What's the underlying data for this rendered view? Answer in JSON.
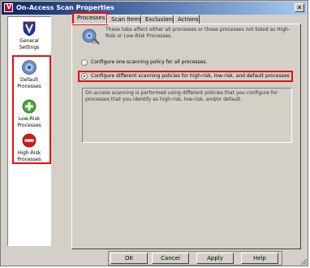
{
  "window": {
    "title": "On-Access Scan Properties",
    "close_label": "✕"
  },
  "sidebar": {
    "items": [
      {
        "id": "general",
        "label_line1": "General",
        "label_line2": "Settings",
        "icon": "shield-v-icon"
      },
      {
        "id": "default",
        "label_line1": "Default",
        "label_line2": "Processes",
        "icon": "gear-disc-icon"
      },
      {
        "id": "lowrisk",
        "label_line1": "Low-Risk",
        "label_line2": "Processes",
        "icon": "green-plus-icon"
      },
      {
        "id": "highrisk",
        "label_line1": "High-Risk",
        "label_line2": "Processes",
        "icon": "red-minus-icon"
      }
    ]
  },
  "tabs": [
    {
      "label": "Processes",
      "active": true
    },
    {
      "label": "Scan Items",
      "active": false
    },
    {
      "label": "Exclusions",
      "active": false
    },
    {
      "label": "Actions",
      "active": false
    }
  ],
  "panel": {
    "info_text": "These tabs affect either all processes or those processes not listed as High-Risk or Low-Risk Processes.",
    "radio_one_label": "Configure one scanning policy for all processes.",
    "radio_two_label": "Configure different scanning policies for high-risk, low-risk, and default processes",
    "selected_radio": 2,
    "description": "On-access scanning is performed using different policies that you configure for processes that you identify as high-risk, low-risk, and/or default."
  },
  "buttons": {
    "ok": "OK",
    "cancel": "Cancel",
    "apply": "Apply",
    "help": "Help"
  },
  "colors": {
    "accent_highlight": "#e01010",
    "titlebar_start": "#0a246a",
    "titlebar_end": "#a6caf0",
    "dialog_bg": "#d4d0c8"
  }
}
